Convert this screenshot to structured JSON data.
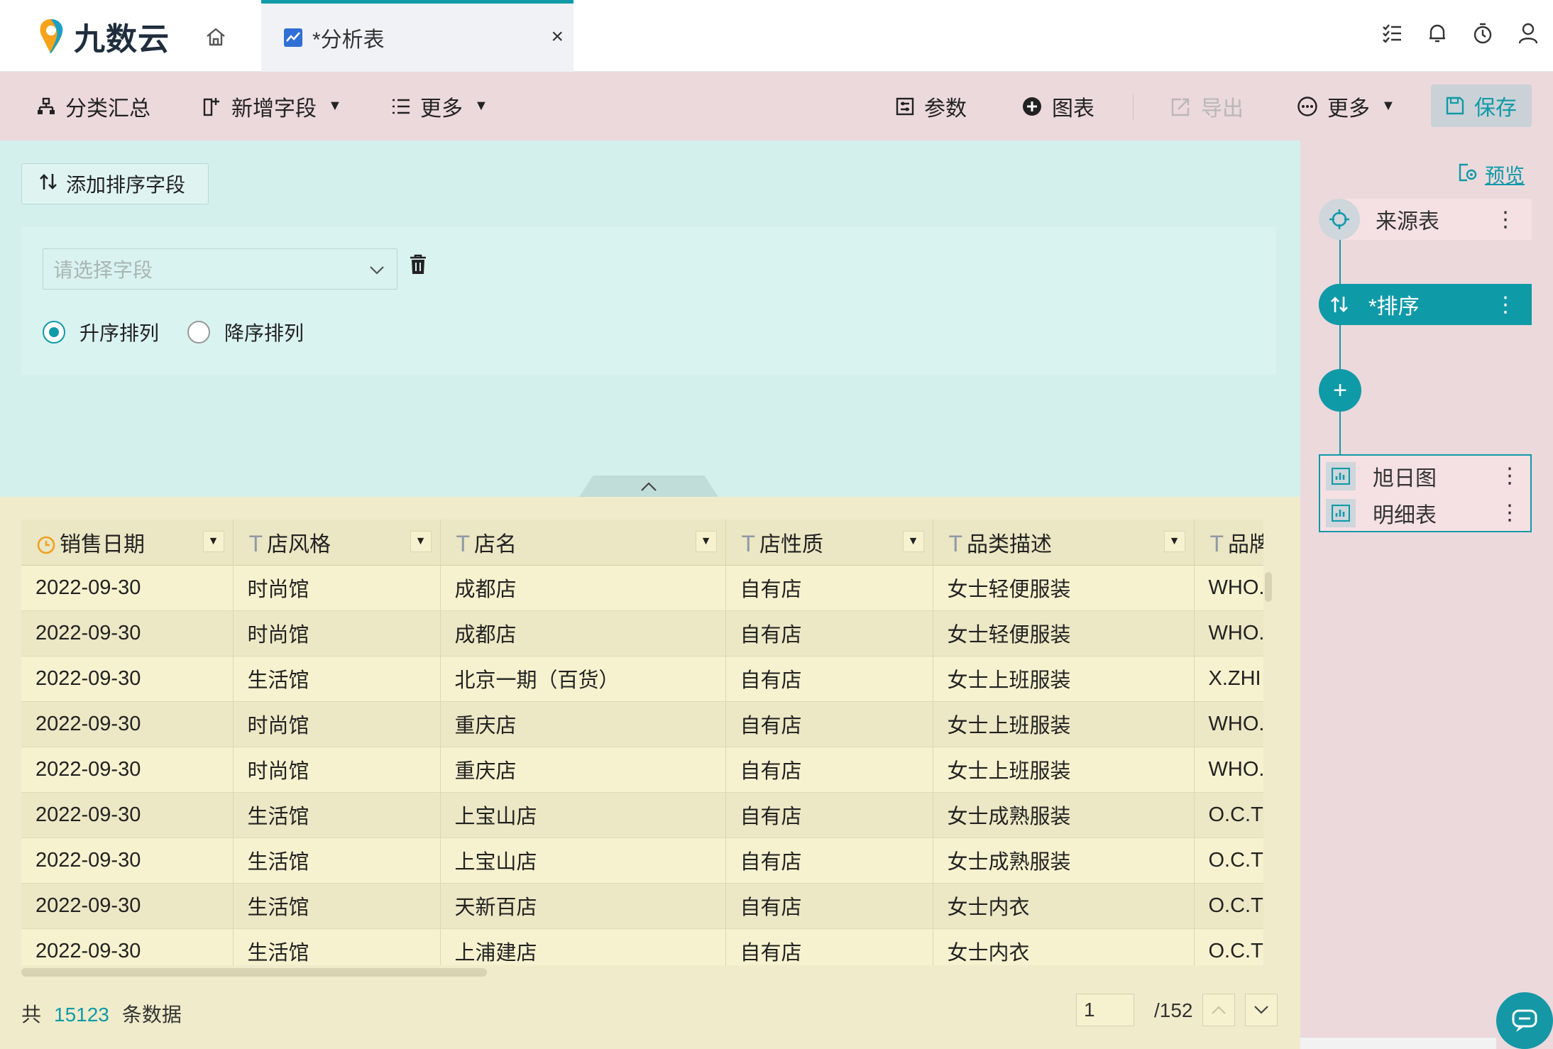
{
  "app": {
    "brand": "九数云"
  },
  "tab": {
    "title": "*分析表",
    "close": "×"
  },
  "toolbar": {
    "group_summary": "分类汇总",
    "add_field": "新增字段",
    "more_left": "更多",
    "params": "参数",
    "chart": "图表",
    "export": "导出",
    "more_right": "更多",
    "save": "保存"
  },
  "sort": {
    "add_button": "添加排序字段",
    "field_placeholder": "请选择字段",
    "asc": "升序排列",
    "desc": "降序排列",
    "selected": "asc"
  },
  "table": {
    "columns": [
      {
        "name": "销售日期",
        "type": "date"
      },
      {
        "name": "店风格",
        "type": "text"
      },
      {
        "name": "店名",
        "type": "text"
      },
      {
        "name": "店性质",
        "type": "text"
      },
      {
        "name": "品类描述",
        "type": "text"
      },
      {
        "name": "品牌",
        "type": "text"
      }
    ],
    "rows": [
      [
        "2022-09-30",
        "时尚馆",
        "成都店",
        "自有店",
        "女士轻便服装",
        "WHO."
      ],
      [
        "2022-09-30",
        "时尚馆",
        "成都店",
        "自有店",
        "女士轻便服装",
        "WHO."
      ],
      [
        "2022-09-30",
        "生活馆",
        "北京一期（百货）",
        "自有店",
        "女士上班服装",
        "X.ZHI"
      ],
      [
        "2022-09-30",
        "时尚馆",
        "重庆店",
        "自有店",
        "女士上班服装",
        "WHO."
      ],
      [
        "2022-09-30",
        "时尚馆",
        "重庆店",
        "自有店",
        "女士上班服装",
        "WHO."
      ],
      [
        "2022-09-30",
        "生活馆",
        "上宝山店",
        "自有店",
        "女士成熟服装",
        "O.C.T"
      ],
      [
        "2022-09-30",
        "生活馆",
        "上宝山店",
        "自有店",
        "女士成熟服装",
        "O.C.T"
      ],
      [
        "2022-09-30",
        "生活馆",
        "天新百店",
        "自有店",
        "女士内衣",
        "O.C.T"
      ],
      [
        "2022-09-30",
        "生活馆",
        "上浦建店",
        "自有店",
        "女士内衣",
        "O.C.T"
      ]
    ]
  },
  "footer": {
    "prefix": "共",
    "count": "15123",
    "suffix": "条数据",
    "page": "1",
    "page_total": "/152"
  },
  "flow": {
    "preview": "预览",
    "source_node": "来源表",
    "sort_node": "*排序",
    "outputs": [
      "旭日图",
      "明细表"
    ]
  },
  "colors": {
    "accent": "#0f9aa8",
    "toolbar_bg": "#ecd9dc",
    "sort_bg": "#d3f0ed",
    "table_bg": "#f0eccb"
  }
}
